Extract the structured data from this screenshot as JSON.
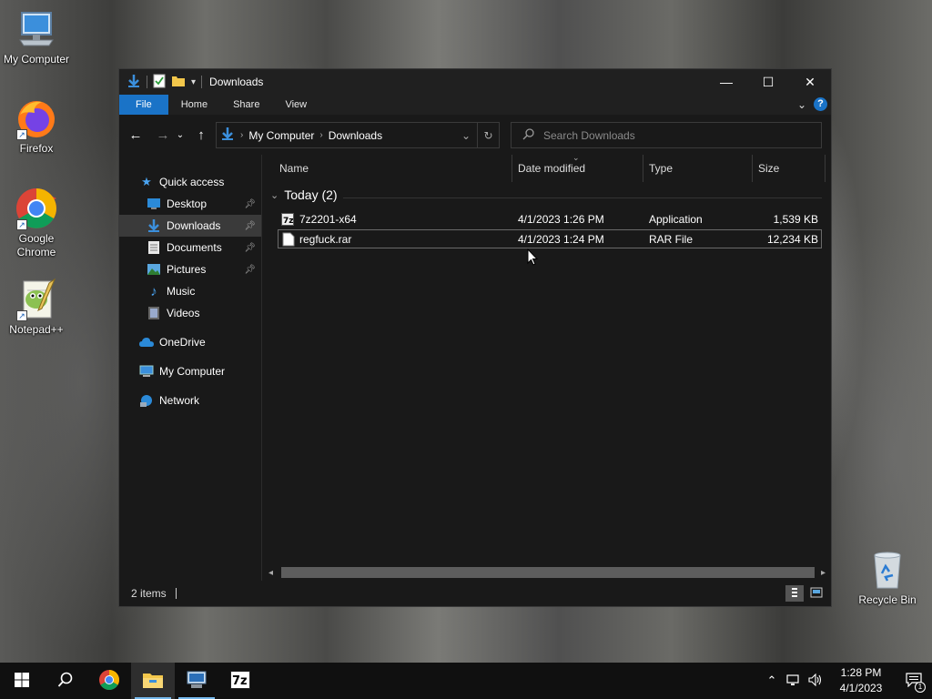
{
  "desktop": {
    "icons": [
      {
        "label": "My Computer",
        "icon": "computer-icon"
      },
      {
        "label": "Firefox",
        "icon": "firefox-icon"
      },
      {
        "label": "Google Chrome",
        "icon": "chrome-icon"
      },
      {
        "label": "Notepad++",
        "icon": "notepadpp-icon"
      },
      {
        "label": "Recycle Bin",
        "icon": "recycle-bin-icon"
      }
    ]
  },
  "window": {
    "title": "Downloads",
    "ribbon_tabs": [
      "File",
      "Home",
      "Share",
      "View"
    ],
    "help": "?",
    "address": {
      "crumbs": [
        "My Computer",
        "Downloads"
      ]
    },
    "search": {
      "placeholder": "Search Downloads"
    },
    "nav": {
      "quick_access": "Quick access",
      "items": [
        {
          "label": "Desktop",
          "pinned": true
        },
        {
          "label": "Downloads",
          "pinned": true,
          "selected": true
        },
        {
          "label": "Documents",
          "pinned": true
        },
        {
          "label": "Pictures",
          "pinned": true
        },
        {
          "label": "Music",
          "pinned": false
        },
        {
          "label": "Videos",
          "pinned": false
        }
      ],
      "onedrive": "OneDrive",
      "my_computer": "My Computer",
      "network": "Network"
    },
    "columns": [
      "Name",
      "Date modified",
      "Type",
      "Size"
    ],
    "group": "Today (2)",
    "files": [
      {
        "name": "7z2201-x64",
        "date": "4/1/2023 1:26 PM",
        "type": "Application",
        "size": "1,539 KB"
      },
      {
        "name": "regfuck.rar",
        "date": "4/1/2023 1:24 PM",
        "type": "RAR File",
        "size": "12,234 KB"
      }
    ],
    "status": "2 items"
  },
  "taskbar": {
    "pinned": [
      "start-icon",
      "search-icon",
      "chrome-icon",
      "file-explorer-icon",
      "network-manager-icon",
      "7zip-icon"
    ],
    "time": "1:28 PM",
    "date": "4/1/2023",
    "notification_count": "1"
  },
  "colors": {
    "accent": "#1a73c7",
    "window_bg": "#191919",
    "titlebar_bg": "#202020",
    "selection_bg": "#3a3a3a",
    "taskbar_bg": "#101010"
  }
}
